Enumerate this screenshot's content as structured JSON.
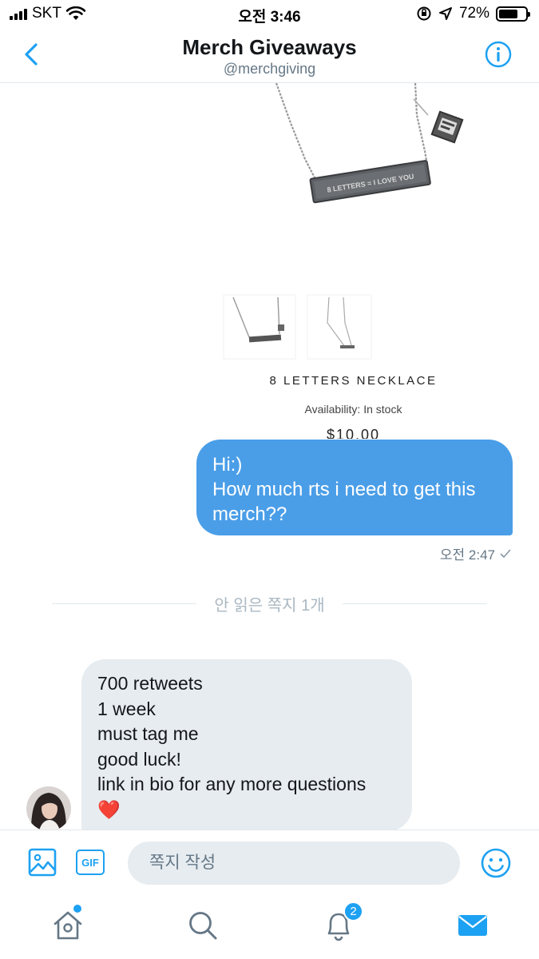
{
  "status_bar": {
    "carrier": "SKT",
    "time": "오전 3:46",
    "battery": "72%",
    "battery_level": 0.72
  },
  "header": {
    "title": "Merch Giveaways",
    "handle": "@merchgiving"
  },
  "product_image": {
    "necklace_engraving": "8 LETTERS = I LOVE YOU",
    "name": "8 LETTERS NECKLACE",
    "availability": "Availability: In stock",
    "price": "$10.00"
  },
  "sent_message": {
    "lines": [
      "Hi:)",
      "How much rts i need to get this",
      "merch??"
    ],
    "time": "오전 2:47"
  },
  "unread_divider": "안 읽은 쪽지 1개",
  "received_message": {
    "lines": [
      "700 retweets",
      "1 week",
      "must tag me",
      "good luck!",
      "link in bio for any more questions"
    ],
    "emoji": "❤️"
  },
  "composer": {
    "placeholder": "쪽지 작성",
    "gif_label": "GIF"
  },
  "tabbar": {
    "notifications_badge": "2",
    "tabs": [
      "home-icon",
      "search-icon",
      "bell-icon",
      "mail-icon"
    ]
  },
  "colors": {
    "accent": "#1da1f2",
    "sent_bubble": "#4a9ee8",
    "received_bubble": "#e6ecf0"
  }
}
